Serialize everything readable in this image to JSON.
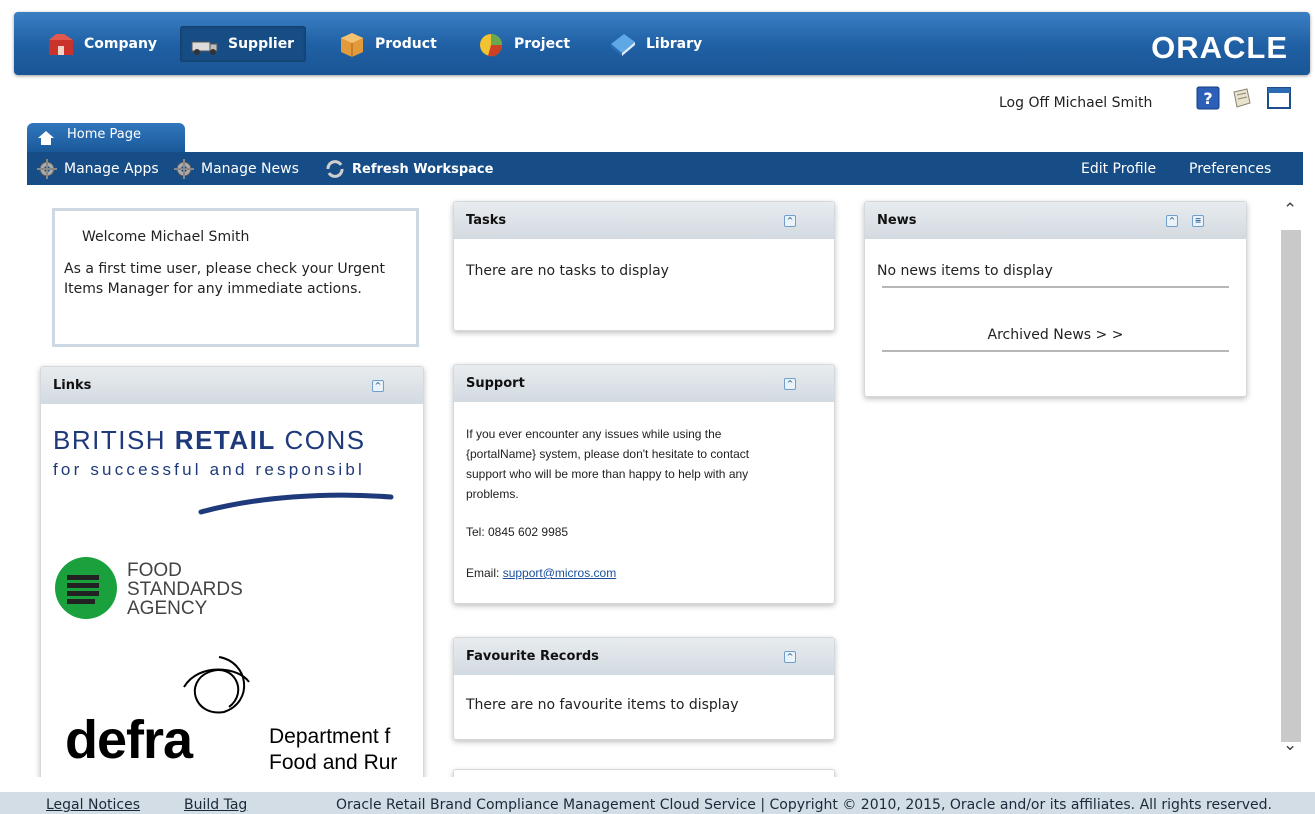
{
  "nav": {
    "items": [
      {
        "label": "Company",
        "icon": "company-icon"
      },
      {
        "label": "Supplier",
        "icon": "supplier-icon"
      },
      {
        "label": "Product",
        "icon": "product-icon"
      },
      {
        "label": "Project",
        "icon": "project-icon"
      },
      {
        "label": "Library",
        "icon": "library-icon"
      }
    ],
    "active": "Supplier",
    "brand": "ORACLE"
  },
  "header": {
    "logoff": "Log Off Michael Smith",
    "icons": [
      "help-icon",
      "scroll-icon",
      "window-icon"
    ]
  },
  "tabs": {
    "home": "Home Page"
  },
  "toolbar": {
    "manage_apps": "Manage Apps",
    "manage_news": "Manage News",
    "refresh": "Refresh Workspace",
    "edit_profile": "Edit Profile",
    "preferences": "Preferences"
  },
  "welcome": {
    "title": "Welcome Michael Smith",
    "line1": "As a first time user, please check your Urgent",
    "line2": "Items Manager for any immediate actions."
  },
  "links": {
    "title": "Links",
    "brc_line1_a": "BRITISH ",
    "brc_line1_b": "RETAIL",
    "brc_line1_c": " CONS",
    "brc_line2": "for successful and responsibl",
    "fsa": [
      "FOOD",
      "STANDARDS",
      "AGENCY"
    ],
    "defra": "defra",
    "defra_sub1": "Department f",
    "defra_sub2": "Food and Rur"
  },
  "tasks": {
    "title": "Tasks",
    "empty": "There are no tasks to display"
  },
  "support": {
    "title": "Support",
    "p1_l1": "If you ever encounter any issues while using the",
    "p1_l2": "{portalName} system, please don't hesitate to contact",
    "p1_l3": "support who will be more than happy to help with any",
    "p1_l4": "problems.",
    "tel": "Tel: 0845 602 9985",
    "email_label": "Email: ",
    "email": "support@micros.com"
  },
  "favourites": {
    "title": "Favourite Records",
    "empty": "There are no favourite items to display"
  },
  "news": {
    "title": "News",
    "empty": "No news items to display",
    "archived": "Archived News > >"
  },
  "footer": {
    "legal": "Legal Notices",
    "build": "Build Tag",
    "copyright": "Oracle Retail Brand Compliance Management Cloud Service  |  Copyright © 2010, 2015, Oracle and/or its affiliates. All rights reserved."
  }
}
